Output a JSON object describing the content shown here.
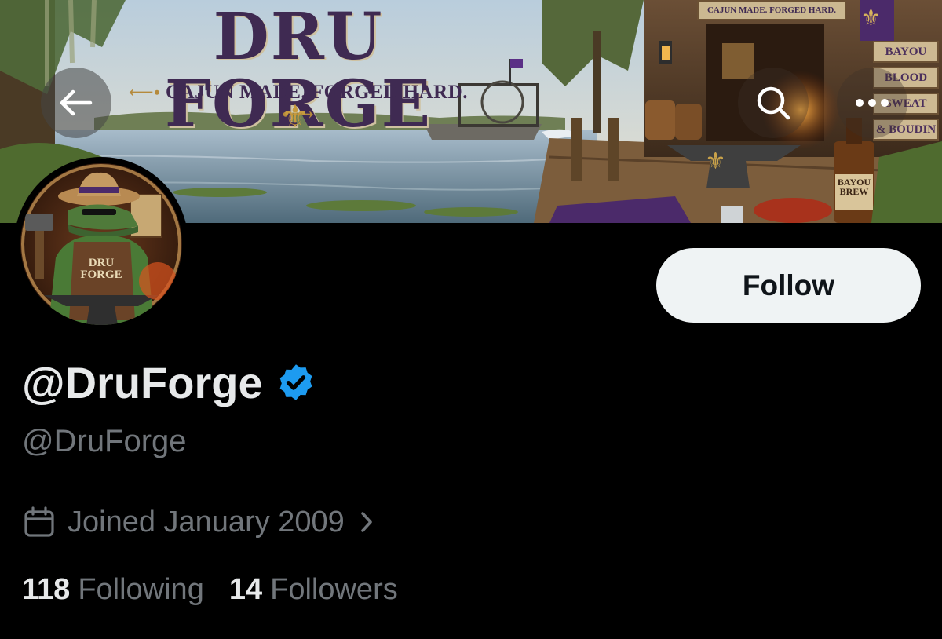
{
  "banner": {
    "title": "DRU FORGE",
    "tagline": "CAJUN MADE. FORGED HARD.",
    "top_sign": "CAJUN MADE. FORGED HARD.",
    "side_signs": [
      "BAYOU",
      "BLOOD",
      "SWEAT",
      "& BOUDIN"
    ],
    "bottle_label": "BAYOU BREW"
  },
  "avatar": {
    "apron_text": "DRU FORGE"
  },
  "nav": {
    "back_icon": "arrow-left-icon",
    "search_icon": "search-icon",
    "more_icon": "more-horizontal-icon"
  },
  "profile": {
    "display_name": "@DruForge",
    "verified": true,
    "handle": "@DruForge",
    "joined": "Joined January 2009",
    "following_count": "118",
    "following_label": "Following",
    "followers_count": "14",
    "followers_label": "Followers"
  },
  "actions": {
    "follow_label": "Follow"
  },
  "colors": {
    "background": "#000000",
    "text_primary": "#e7e9ea",
    "text_secondary": "#71767b",
    "verified_blue": "#1d9bf0",
    "follow_bg": "#eff3f4",
    "banner_purple": "#3f2a52"
  }
}
